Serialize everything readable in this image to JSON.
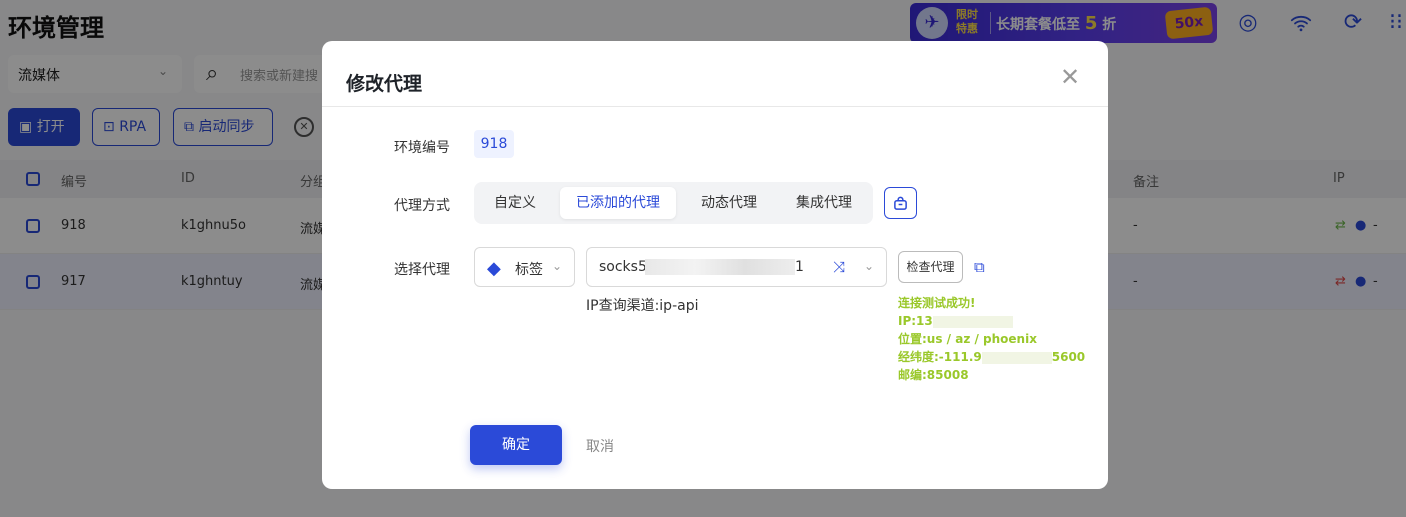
{
  "page": {
    "title": "环境管理",
    "promo": {
      "limited": "限时特惠",
      "text_prefix": "长期套餐低至",
      "text_number": "5",
      "text_suffix": "折",
      "badge": "50x"
    },
    "group_select": "流媒体",
    "search_placeholder": "搜索或新建搜",
    "toolbar": {
      "open_label": "打开",
      "rpa_label": "RPA",
      "sync_label": "启动同步"
    },
    "table": {
      "headers": {
        "number": "编号",
        "id": "ID",
        "group": "分组",
        "remark": "备注",
        "ip": "IP"
      },
      "rows": [
        {
          "number": "918",
          "id": "k1ghnu5o",
          "group": "流媒",
          "remark": "-",
          "ip": "-"
        },
        {
          "number": "917",
          "id": "k1ghntuy",
          "group": "流媒",
          "remark": "-",
          "ip": "-"
        }
      ]
    }
  },
  "modal": {
    "title": "修改代理",
    "env_label": "环境编号",
    "env_value": "918",
    "proxy_mode_label": "代理方式",
    "proxy_modes": [
      "自定义",
      "已添加的代理",
      "动态代理",
      "集成代理"
    ],
    "active_mode": "已添加的代理",
    "select_proxy_label": "选择代理",
    "tag_select": "标签",
    "proxy_value_prefix": "socks5:",
    "proxy_value_suffix": "1",
    "query_channel": "IP查询渠道:ip-api",
    "check_button": "检查代理",
    "result": {
      "line1": "连接测试成功!",
      "line2_prefix": "IP:13",
      "line3": "位置:us / az / phoenix",
      "line4_prefix": "经纬度:-111.9",
      "line4_suffix": "5600",
      "line5": "邮编:85008"
    },
    "ok_button": "确定",
    "cancel_button": "取消"
  },
  "colors": {
    "accent": "#2b4ad8",
    "success": "#9ac82a"
  }
}
